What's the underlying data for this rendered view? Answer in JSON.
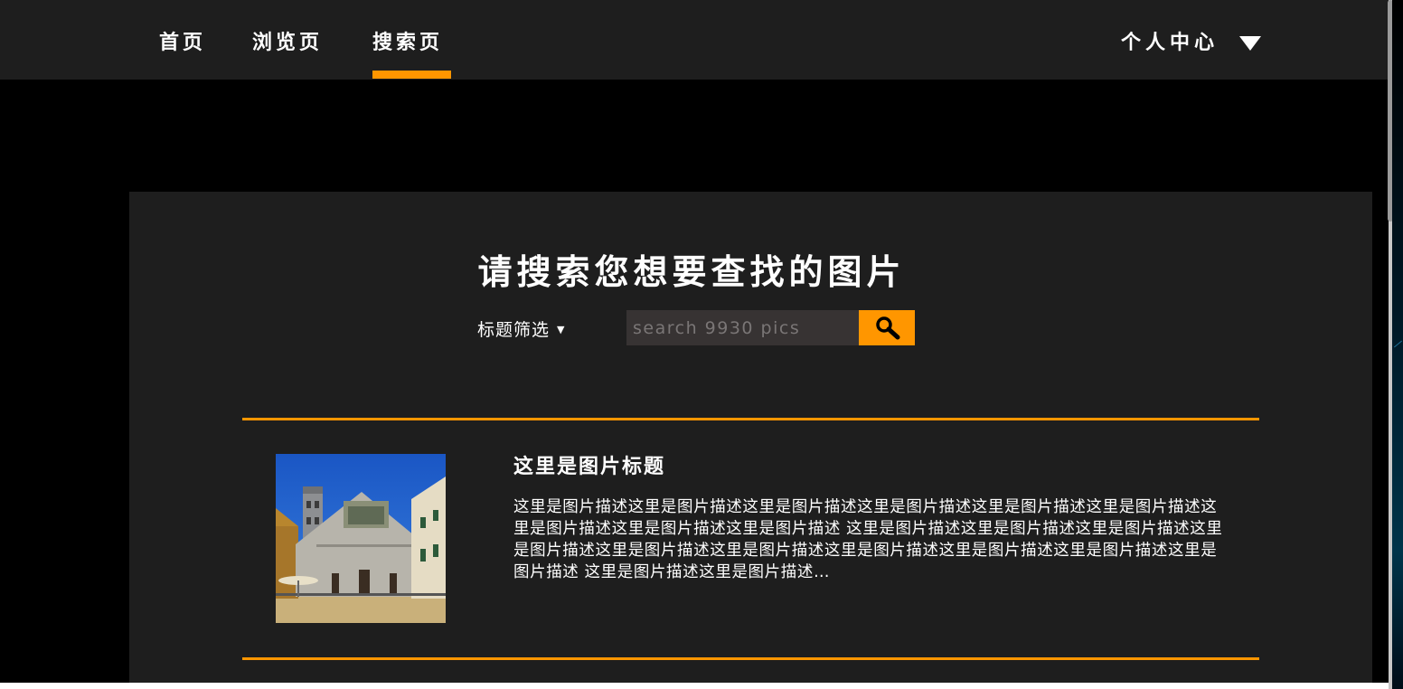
{
  "nav": {
    "items": [
      {
        "label": "首页"
      },
      {
        "label": "浏览页"
      },
      {
        "label": "搜索页"
      }
    ],
    "active_index": 2,
    "user_menu_label": "个人中心"
  },
  "search": {
    "heading": "请搜索您想要查找的图片",
    "filter_label": "标题筛选",
    "placeholder": "search 9930 pics"
  },
  "results": [
    {
      "title": "这里是图片标题",
      "description": "这里是图片描述这里是图片描述这里是图片描述这里是图片描述这里是图片描述这里是图片描述这里是图片描述这里是图片描述这里是图片描述 这里是图片描述这里是图片描述这里是图片描述这里是图片描述这里是图片描述这里是图片描述这里是图片描述这里是图片描述这里是图片描述这里是图片描述 这里是图片描述这里是图片描述…"
    }
  ],
  "colors": {
    "accent": "#ff9600",
    "navbar_bg": "#1e1e1e",
    "panel_bg": "#1e1e1e",
    "page_bg": "#000000",
    "input_bg": "#373333"
  },
  "icons": {
    "search": "magnifier-icon",
    "user_menu": "caret-down-icon",
    "filter": "caret-down-small-icon"
  }
}
